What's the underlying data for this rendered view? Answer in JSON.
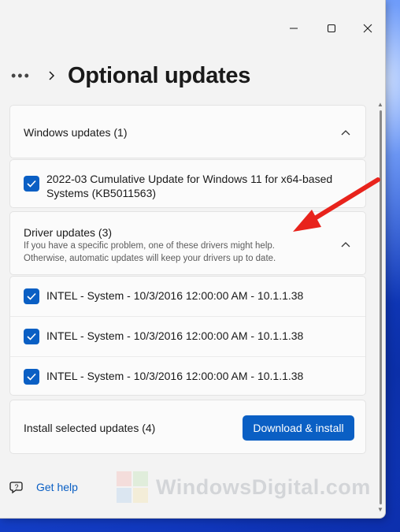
{
  "window": {
    "caption_buttons": {
      "minimize": "minimize-icon",
      "maximize": "maximize-icon",
      "close": "close-icon"
    }
  },
  "header": {
    "more_label": "•••",
    "title": "Optional updates"
  },
  "windows_updates": {
    "title": "Windows updates (1)",
    "items": [
      {
        "line1": "2022-03 Cumulative Update for Windows 11 for x64-based",
        "line2": "Systems (KB5011563)",
        "checked": true
      }
    ]
  },
  "driver_updates": {
    "title": "Driver updates (3)",
    "description_line1": "If you have a specific problem, one of these drivers might help.",
    "description_line2": "Otherwise, automatic updates will keep your drivers up to date.",
    "items": [
      {
        "label": "INTEL - System - 10/3/2016 12:00:00 AM - 10.1.1.38",
        "checked": true
      },
      {
        "label": "INTEL - System - 10/3/2016 12:00:00 AM - 10.1.1.38",
        "checked": true
      },
      {
        "label": "INTEL - System - 10/3/2016 12:00:00 AM - 10.1.1.38",
        "checked": true
      }
    ]
  },
  "install_bar": {
    "label": "Install selected updates (4)",
    "button": "Download & install"
  },
  "help": {
    "label": "Get help"
  },
  "watermark": {
    "text": "WindowsDigital.com"
  },
  "colors": {
    "accent": "#0a5fc4",
    "arrow": "#e8231c",
    "window_bg": "#f3f3f3",
    "card_bg": "#fbfbfb"
  }
}
